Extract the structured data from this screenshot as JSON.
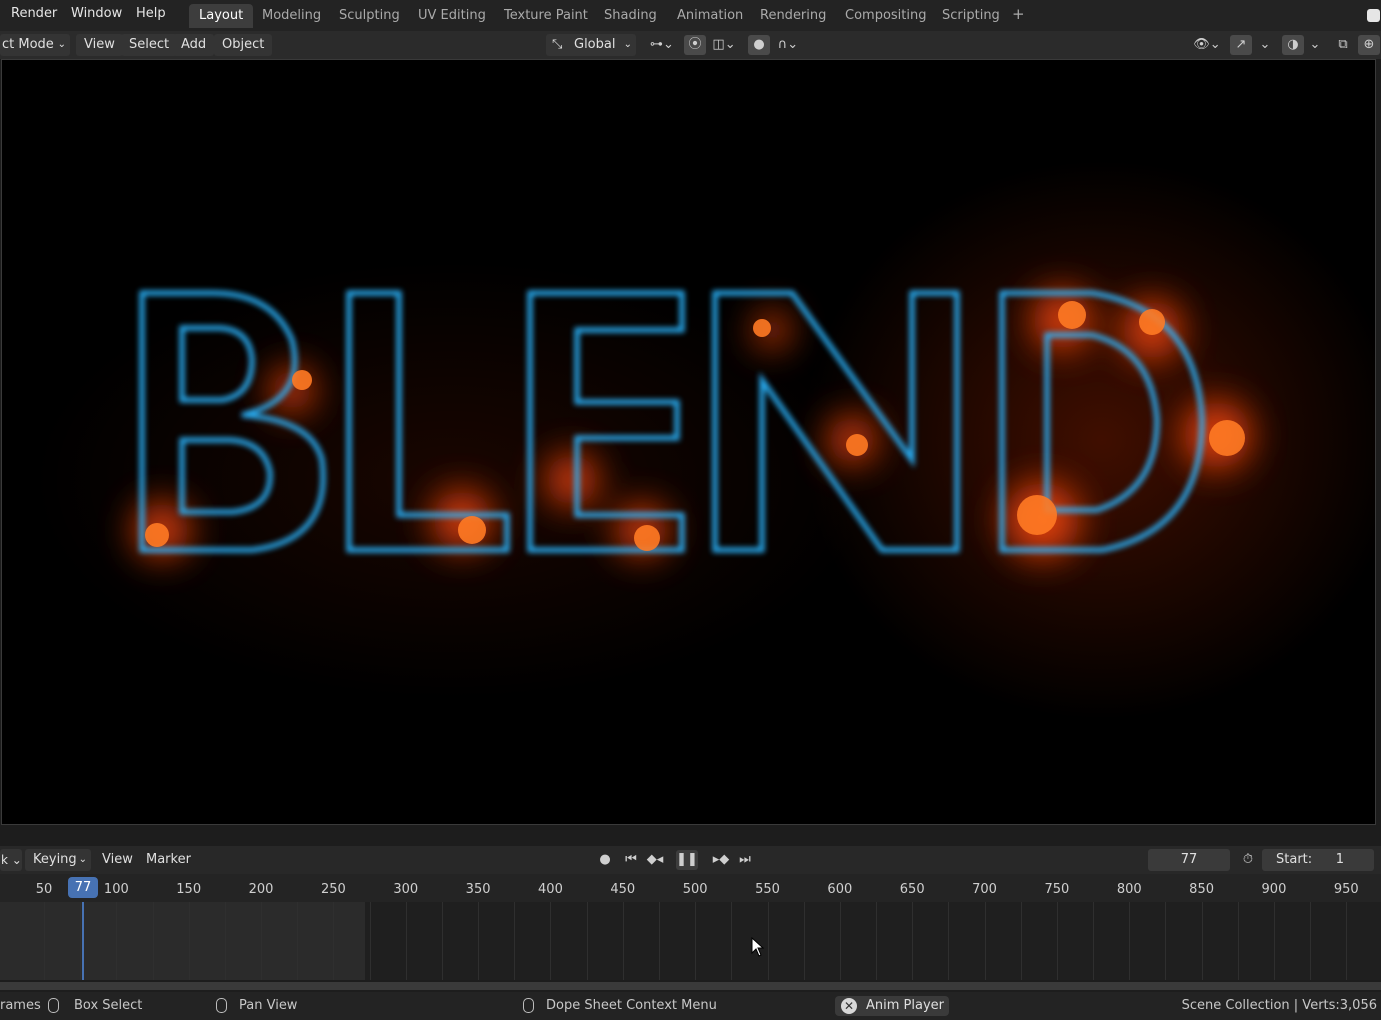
{
  "menu": {
    "render": "Render",
    "window": "Window",
    "help": "Help"
  },
  "workspaces": [
    "Layout",
    "Modeling",
    "Sculpting",
    "UV Editing",
    "Texture Paint",
    "Shading",
    "Animation",
    "Rendering",
    "Compositing",
    "Scripting"
  ],
  "workspace_add": "+",
  "viewport_header": {
    "mode": "ct Mode",
    "view": "View",
    "select": "Select",
    "add": "Add",
    "object": "Object",
    "orientation": "Global"
  },
  "scene_text": "BLEND",
  "timeline": {
    "keying": "Keying",
    "view": "View",
    "marker": "Marker",
    "current_frame": "77",
    "start_label": "Start:",
    "start_value": "1",
    "playhead": 77,
    "ticks": [
      "50",
      "100",
      "150",
      "200",
      "250",
      "300",
      "350",
      "400",
      "450",
      "500",
      "550",
      "600",
      "650",
      "700",
      "750",
      "800",
      "850",
      "900",
      "950"
    ]
  },
  "status": {
    "frames": "rames",
    "box_select": "Box Select",
    "pan_view": "Pan View",
    "context_menu": "Dope Sheet Context Menu",
    "anim_player": "Anim Player",
    "stats": "Scene Collection | Verts:3,056"
  },
  "colors": {
    "accent": "#4772b3",
    "fire": "#ff5a10",
    "ice": "#27b8ff",
    "panel": "#2b2b2b"
  }
}
